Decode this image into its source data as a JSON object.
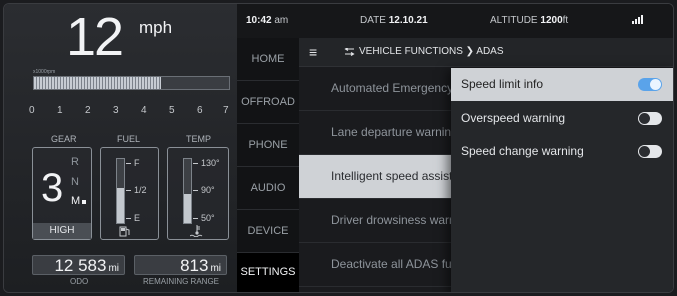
{
  "cluster": {
    "speed": "12",
    "speed_unit": "mph",
    "rpm_label": "x1000rpm",
    "rpm_ticks": [
      "0",
      "1",
      "2",
      "3",
      "4",
      "5",
      "6",
      "7"
    ],
    "rpm_level": 0.65,
    "gear": {
      "header": "GEAR",
      "current": "3",
      "options": [
        "R",
        "N",
        "M"
      ],
      "mode": "HIGH"
    },
    "fuel": {
      "header": "FUEL",
      "full": "F",
      "half": "1/2",
      "empty": "E",
      "level": 0.55
    },
    "temp": {
      "header": "TEMP",
      "high": "130°",
      "mid": "90°",
      "low": "50°",
      "level": 0.45
    },
    "odo": {
      "value": "12 583",
      "unit": "mi",
      "caption": "ODO"
    },
    "range": {
      "value": "813",
      "unit": "mi",
      "caption": "REMAINING RANGE"
    }
  },
  "status": {
    "time": "10:42",
    "time_suffix": "am",
    "date_label": "DATE",
    "date": "12.10.21",
    "altitude_label": "ALTITUDE",
    "altitude": "1200",
    "altitude_unit": "ft"
  },
  "tabs": [
    "HOME",
    "OFFROAD",
    "PHONE",
    "AUDIO",
    "DEVICE",
    "SETTINGS"
  ],
  "breadcrumb": "VEHICLE FUNCTIONS  ❯  ADAS",
  "functions": [
    "Automated Emergency",
    "Lane departure warnin",
    "Intelligent speed assist",
    "Driver drowsiness warr",
    "Deactivate all ADAS fu"
  ],
  "popup": [
    {
      "label": "Speed limit info",
      "on": true
    },
    {
      "label": "Overspeed warning",
      "on": false
    },
    {
      "label": "Speed change warning",
      "on": false
    }
  ],
  "colors": {
    "accent": "#5aa3ea",
    "selected_bg": "#cfd2d6"
  }
}
